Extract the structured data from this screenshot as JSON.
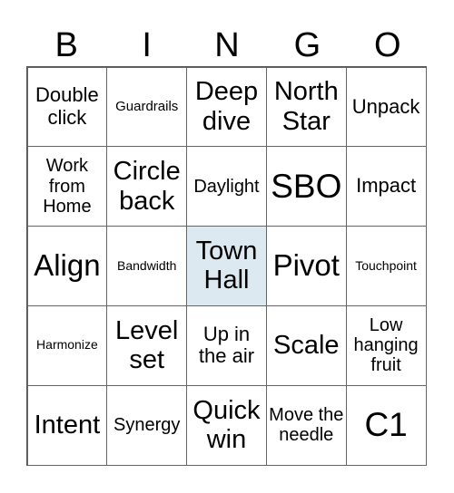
{
  "header": [
    "B",
    "I",
    "N",
    "G",
    "O"
  ],
  "free_space_index": 12,
  "colors": {
    "free_space_bg": "#dde9f0",
    "border": "#666666"
  },
  "cells": [
    {
      "text": "Double click",
      "size": "s20"
    },
    {
      "text": "Guardrails",
      "size": "s12"
    },
    {
      "text": "Deep dive",
      "size": "s26"
    },
    {
      "text": "North Star",
      "size": "s26"
    },
    {
      "text": "Unpack",
      "size": "s20"
    },
    {
      "text": "Work from Home",
      "size": "s16"
    },
    {
      "text": "Circle back",
      "size": "s26"
    },
    {
      "text": "Daylight",
      "size": "s16"
    },
    {
      "text": "SBO",
      "size": "s36"
    },
    {
      "text": "Impact",
      "size": "s20"
    },
    {
      "text": "Align",
      "size": "s30"
    },
    {
      "text": "Bandwidth",
      "size": "s10"
    },
    {
      "text": "Town Hall",
      "size": "s26"
    },
    {
      "text": "Pivot",
      "size": "s30"
    },
    {
      "text": "Touchpoint",
      "size": "s10"
    },
    {
      "text": "Harmonize",
      "size": "s10"
    },
    {
      "text": "Level set",
      "size": "s26"
    },
    {
      "text": "Up in the air",
      "size": "s20"
    },
    {
      "text": "Scale",
      "size": "s26"
    },
    {
      "text": "Low hanging fruit",
      "size": "s16"
    },
    {
      "text": "Intent",
      "size": "s26"
    },
    {
      "text": "Synergy",
      "size": "s16"
    },
    {
      "text": "Quick win",
      "size": "s26"
    },
    {
      "text": "Move the needle",
      "size": "s16"
    },
    {
      "text": "C1",
      "size": "s36"
    }
  ]
}
